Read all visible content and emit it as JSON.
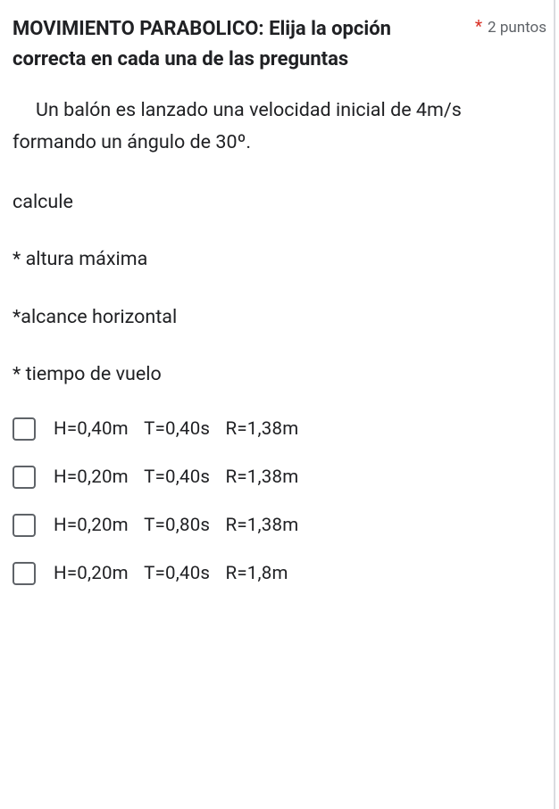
{
  "header": {
    "title": "MOVIMIENTO PARABOLICO: Elija la opción correcta en cada una de las preguntas",
    "required_mark": "*",
    "points": "2 puntos"
  },
  "body": {
    "paragraph": "Un balón es lanzado una velocidad inicial de 4m/s formando un ángulo de 30º.",
    "calc_label": "calcule",
    "items": [
      "* altura máxima",
      "*alcance horizontal",
      "* tiempo de vuelo"
    ]
  },
  "options": [
    {
      "h": "H=0,40m",
      "t": "T=0,40s",
      "r": "R=1,38m"
    },
    {
      "h": "H=0,20m",
      "t": "T=0,40s",
      "r": "R=1,38m"
    },
    {
      "h": "H=0,20m",
      "t": "T=0,80s",
      "r": "R=1,38m"
    },
    {
      "h": "H=0,20m",
      "t": "T=0,40s",
      "r": "R=1,8m"
    }
  ]
}
